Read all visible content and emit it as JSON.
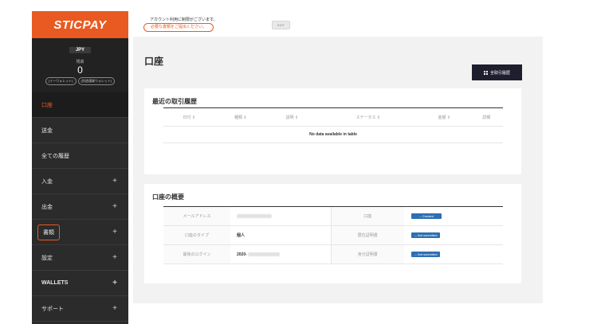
{
  "brand": {
    "logo_text": "STICPAY",
    "accent_color": "#e85a22"
  },
  "sidebar": {
    "currency": "JPY",
    "balance_label": "残高",
    "balance_value": "0",
    "wallet_buttons": [
      "(イーウォレット)",
      "(別途通貨ウォレット)"
    ],
    "items": [
      {
        "label": "口座",
        "has_plus": false,
        "active": true
      },
      {
        "label": "送金",
        "has_plus": false
      },
      {
        "label": "全ての履歴",
        "has_plus": false
      },
      {
        "label": "入金",
        "has_plus": true
      },
      {
        "label": "出金",
        "has_plus": true
      },
      {
        "label": "書類",
        "has_plus": true,
        "highlighted": true
      },
      {
        "label": "設定",
        "has_plus": true
      },
      {
        "label": "WALLETS",
        "has_plus": true
      },
      {
        "label": "サポート",
        "has_plus": true
      }
    ],
    "plus_symbol": "+"
  },
  "notice": {
    "line1": "アカウント利用に制限がございます。",
    "line2": "必要な書類をご提出ください。",
    "edit_label": "EDIT"
  },
  "main": {
    "title": "口座",
    "all_transactions_label": "全取引履歴",
    "recent": {
      "title": "最近の取引履歴",
      "columns": [
        "日付 ⇕",
        "種類 ⇕",
        "説明 ⇕",
        "ステータス ⇕",
        "金額 ⇕",
        "詳細"
      ],
      "empty_text": "No data available in table"
    },
    "overview": {
      "title": "口座の概要",
      "rows": [
        {
          "key": "メールアドレス",
          "value": "",
          "key2": "口座",
          "status": "-- Created"
        },
        {
          "key": "口座のタイプ",
          "value": "個人",
          "key2": "居住証明書",
          "status": "-- Not submitted"
        },
        {
          "key": "最後のログイン",
          "value": "2020-",
          "key2": "身分証明書",
          "status": "-- Not submitted"
        }
      ]
    }
  }
}
